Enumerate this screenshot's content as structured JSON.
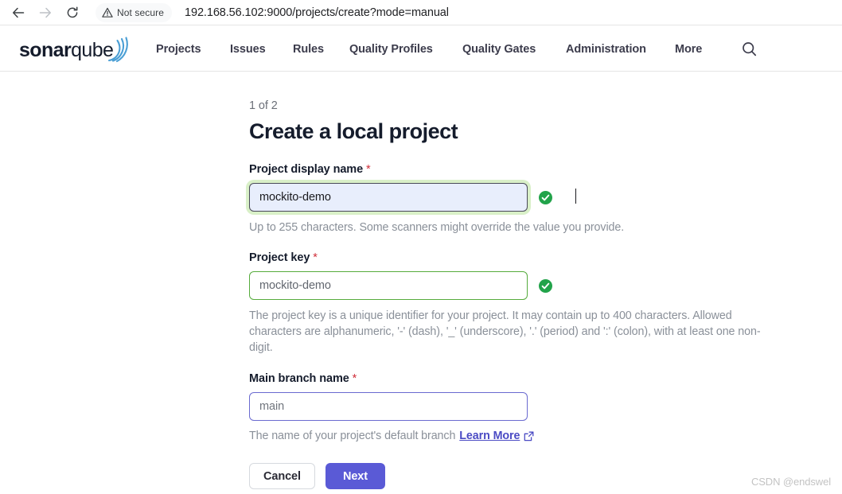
{
  "browser": {
    "back_icon": "back-arrow-icon",
    "forward_icon": "forward-arrow-icon",
    "reload_icon": "reload-icon",
    "security_icon": "warning-triangle-icon",
    "security_label": "Not secure",
    "url": "192.168.56.102:9000/projects/create?mode=manual"
  },
  "navbar": {
    "logo": {
      "bold_part": "sonar",
      "light_part": "qube",
      "arcs_color": "#4b9fd5"
    },
    "items": [
      {
        "label": "Projects"
      },
      {
        "label": "Issues"
      },
      {
        "label": "Rules"
      },
      {
        "label": "Quality Profiles"
      },
      {
        "label": "Quality Gates"
      },
      {
        "label": "Administration"
      },
      {
        "label": "More"
      }
    ],
    "search_icon": "search-icon"
  },
  "main": {
    "step_indicator": "1 of 2",
    "title": "Create a local project",
    "fields": [
      {
        "label": "Project display name",
        "required_marker": "*",
        "value": "mockito-demo",
        "placeholder": "",
        "state": "focused-valid",
        "valid_icon": "check-circle-icon",
        "helper": "Up to 255 characters. Some scanners might override the value you provide."
      },
      {
        "label": "Project key",
        "required_marker": "*",
        "value": "mockito-demo",
        "placeholder": "",
        "state": "valid",
        "valid_icon": "check-circle-icon",
        "helper": "The project key is a unique identifier for your project. It may contain up to 400 characters. Allowed characters are alphanumeric, '-' (dash), '_' (underscore), '.' (period) and ':' (colon), with at least one non-digit."
      },
      {
        "label": "Main branch name",
        "required_marker": "*",
        "value": "main",
        "placeholder": "main",
        "state": "default",
        "helper_prefix": "The name of your project's default branch",
        "helper_link": "Learn More",
        "helper_link_icon": "external-link-icon"
      }
    ],
    "buttons": {
      "cancel_label": "Cancel",
      "next_label": "Next"
    }
  },
  "watermark": "CSDN @endswel",
  "colors": {
    "accent": "#5a5ad6",
    "valid": "#22a34a",
    "required": "#d02f3a",
    "logo_blue": "#4b9fd5",
    "helper_text": "#8a9099"
  }
}
